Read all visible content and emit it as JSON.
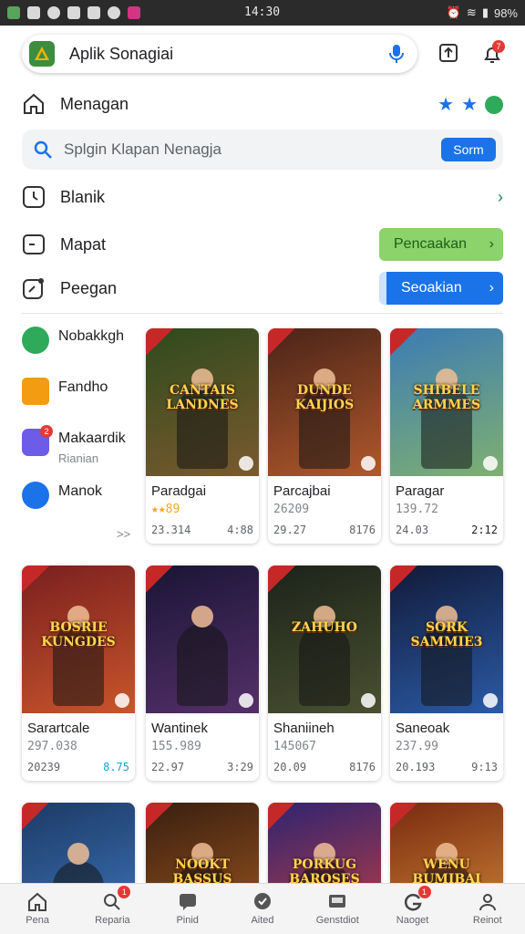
{
  "status_bar": {
    "time": "14:30",
    "battery": "98%"
  },
  "top_bar": {
    "title": "Aplik Sonagiai",
    "notification_count": "7"
  },
  "home": {
    "label": "Menagan"
  },
  "search": {
    "placeholder": "Splgin Klapan Nenagja",
    "button": "Sorm"
  },
  "rows": [
    {
      "label": "Blanik",
      "icon": "clock-icon"
    },
    {
      "label": "Mapat",
      "icon": "window-icon",
      "action": "Pencaakan"
    },
    {
      "label": "Peegan",
      "icon": "edit-icon",
      "action": "Seoakian"
    }
  ],
  "categories": [
    {
      "label": "Nobakkgh",
      "icon": "green-circle-icon",
      "color": "#2eaa5a"
    },
    {
      "label": "Fandho",
      "icon": "box-icon",
      "color": "#f39c12"
    },
    {
      "label": "Makaardik",
      "sub": "Rianian",
      "icon": "puzzle-icon",
      "color": "#6c5ce7",
      "badge": "2"
    },
    {
      "label": "Manok",
      "icon": "blue-circle-icon",
      "color": "#1a73e8"
    }
  ],
  "more_link": ">>",
  "cards": [
    {
      "name": "Paradgai",
      "meta": "★★89",
      "left": "23.314",
      "right": "4:88",
      "logo": "CANTAIS LANDNES",
      "bg": [
        "#2e4a1d",
        "#7a5a2e"
      ]
    },
    {
      "name": "Parcajbai",
      "meta": "26209",
      "left": "29.27",
      "right": "8176",
      "logo": "DUNDE KAIJIOS",
      "bg": [
        "#4a2418",
        "#b0582c"
      ]
    },
    {
      "name": "Paragar",
      "meta": "139.72",
      "left": "24.03",
      "right": "2:12",
      "logo": "SHIBELE ARMMES",
      "bg": [
        "#3b7bb5",
        "#7fb070"
      ]
    },
    {
      "name": "Sarartcale",
      "meta": "297.038",
      "left": "20239",
      "right": "8.75",
      "logo": "BOSRIE KUNGDES",
      "bg": [
        "#7a1f1f",
        "#c8552b"
      ]
    },
    {
      "name": "Wantinek",
      "meta": "155.989",
      "left": "22.97",
      "right": "3:29",
      "logo": "",
      "bg": [
        "#1a1535",
        "#54306a"
      ]
    },
    {
      "name": "Shaniineh",
      "meta": "145067",
      "left": "20.09",
      "right": "8176",
      "logo": "ZAHUHO",
      "bg": [
        "#1c231a",
        "#4a5030"
      ]
    },
    {
      "name": "Saneoak",
      "meta": "237.99",
      "left": "20.193",
      "right": "9:13",
      "logo": "SORK SAMMIE3",
      "bg": [
        "#111a38",
        "#2b5aa6"
      ]
    },
    {
      "name": "",
      "meta": "",
      "left": "",
      "right": "",
      "logo": "",
      "bg": [
        "#1d3a66",
        "#3f7ac0"
      ]
    },
    {
      "name": "",
      "meta": "",
      "left": "",
      "right": "",
      "logo": "NOOKT BASSUS",
      "bg": [
        "#3a1f10",
        "#a35a20"
      ]
    },
    {
      "name": "",
      "meta": "",
      "left": "",
      "right": "",
      "logo": "PORKUG BAROSES",
      "bg": [
        "#2f2470",
        "#c84040"
      ]
    },
    {
      "name": "",
      "meta": "",
      "left": "",
      "right": "",
      "logo": "WENU BUMIBAI",
      "bg": [
        "#7a2a10",
        "#d8903a"
      ]
    }
  ],
  "bottom_nav": [
    {
      "label": "Pena",
      "icon": "home-icon"
    },
    {
      "label": "Reparia",
      "icon": "search-icon",
      "badge": "1"
    },
    {
      "label": "Pinid",
      "icon": "chat-icon"
    },
    {
      "label": "Aited",
      "icon": "check-circle-icon"
    },
    {
      "label": "Genstdiot",
      "icon": "screen-icon"
    },
    {
      "label": "Naoget",
      "icon": "g-icon",
      "badge": "1"
    },
    {
      "label": "Reinot",
      "icon": "person-icon"
    }
  ]
}
